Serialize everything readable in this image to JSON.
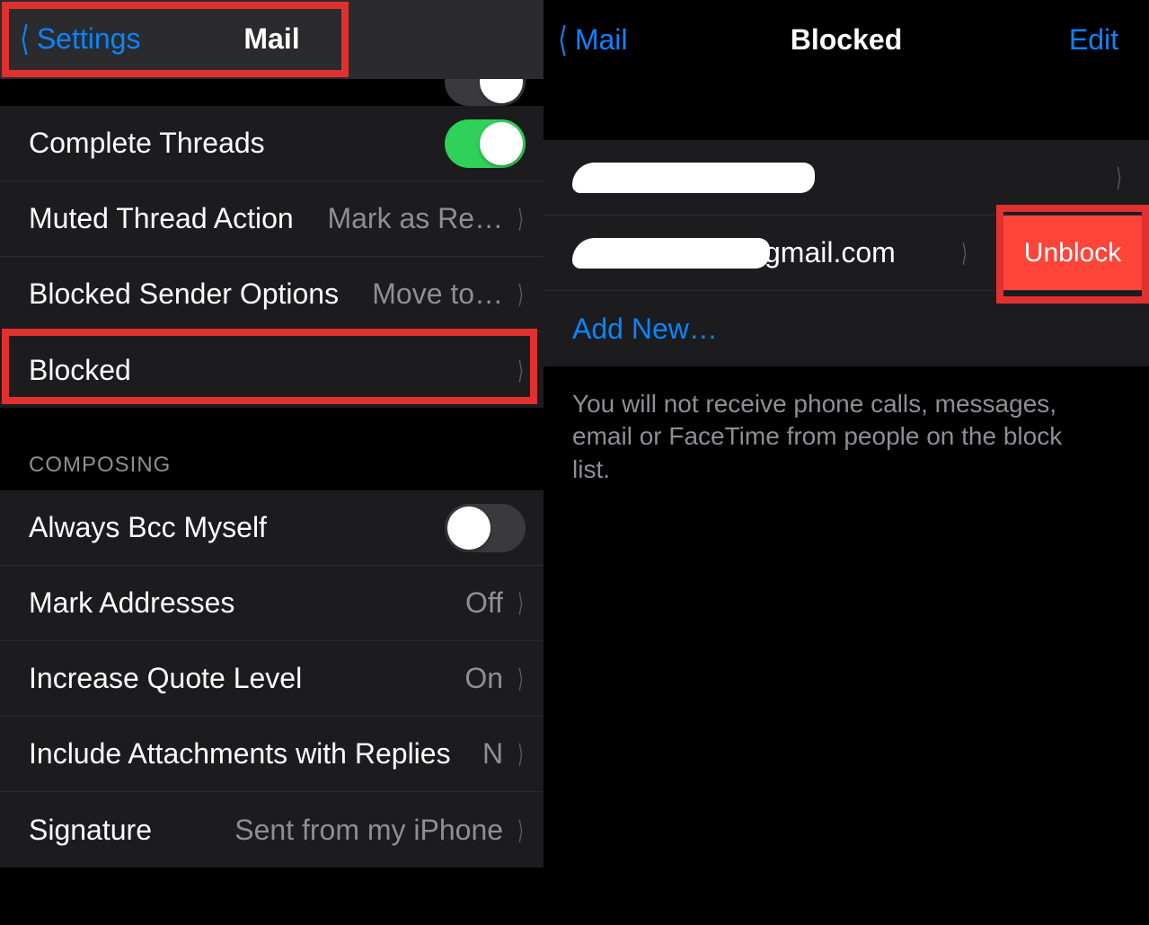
{
  "left": {
    "nav": {
      "back": "Settings",
      "title": "Mail"
    },
    "rows": {
      "complete_threads": {
        "label": "Complete Threads",
        "on": true
      },
      "muted_action": {
        "label": "Muted Thread Action",
        "value": "Mark as Re…"
      },
      "blocked_options": {
        "label": "Blocked Sender Options",
        "value": "Move to…"
      },
      "blocked": {
        "label": "Blocked"
      }
    },
    "section_header": "COMPOSING",
    "composing": {
      "always_bcc": {
        "label": "Always Bcc Myself",
        "on": false
      },
      "mark_addresses": {
        "label": "Mark Addresses",
        "value": "Off"
      },
      "increase_quote": {
        "label": "Increase Quote Level",
        "value": "On"
      },
      "include_attach": {
        "label": "Include Attachments with Replies",
        "value": "N"
      },
      "signature": {
        "label": "Signature",
        "value": "Sent from my iPhone"
      }
    }
  },
  "right": {
    "nav": {
      "back": "Mail",
      "title": "Blocked",
      "edit": "Edit"
    },
    "row2_suffix": "gmail.com",
    "unblock": "Unblock",
    "add_new": "Add New…",
    "footer": "You will not receive phone calls, messages, email or FaceTime from people on the block list."
  }
}
